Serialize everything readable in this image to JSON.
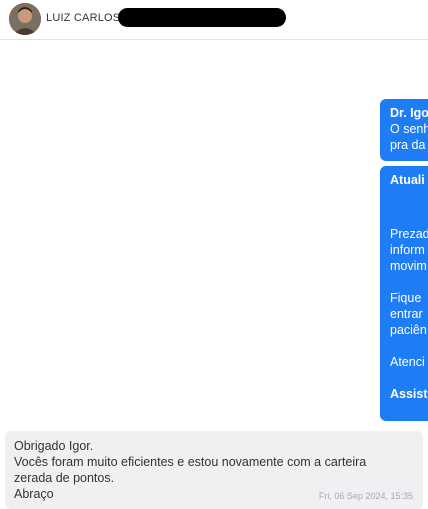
{
  "header": {
    "contact_name": "LUIZ CARLOS"
  },
  "messages_out": [
    {
      "lines": [
        {
          "text": "Dr. Igo",
          "bold": true
        },
        {
          "text": "O senh",
          "bold": false
        },
        {
          "text": "pra da",
          "bold": false
        }
      ]
    },
    {
      "lines": [
        {
          "text": "Atuali",
          "bold": true
        },
        {
          "text": "",
          "bold": false
        },
        {
          "text": "",
          "bold": false
        },
        {
          "text": "Prezad",
          "bold": false
        },
        {
          "text": "inform",
          "bold": false
        },
        {
          "text": "movim",
          "bold": false
        },
        {
          "text": "",
          "bold": false
        },
        {
          "text": "Fique",
          "bold": false
        },
        {
          "text": "entrar",
          "bold": false
        },
        {
          "text": "paciên",
          "bold": false
        },
        {
          "text": "",
          "bold": false
        },
        {
          "text": "Atenci",
          "bold": false
        },
        {
          "text": "",
          "bold": false
        },
        {
          "text": "Assist",
          "bold": true
        }
      ]
    }
  ],
  "message_in": {
    "lines": [
      "Obrigado Igor.",
      "Vocês foram muito eficientes e estou novamente com a carteira",
      "zerada de pontos.",
      "Abraço"
    ],
    "timestamp": "Fri, 06 Sep 2024, 15:35"
  }
}
